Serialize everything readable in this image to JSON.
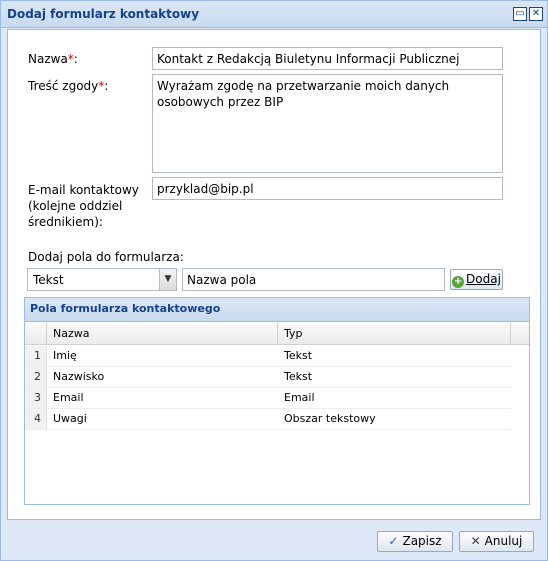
{
  "window": {
    "title": "Dodaj formularz kontaktowy"
  },
  "form": {
    "name_label": "Nazwa",
    "name_value": "Kontakt z Redakcją Biuletynu Informacji Publicznej",
    "consent_label": "Treść zgody",
    "consent_value": "Wyrażam zgodę na przetwarzanie moich danych osobowych przez BIP",
    "email_label_1": "E-mail kontaktowy",
    "email_label_2": "(kolejne oddziel",
    "email_label_3": "średnikiem):",
    "email_value": "przyklad@bip.pl",
    "add_fields_label": "Dodaj pola do formularza:",
    "type_select_value": "Tekst",
    "field_name_value": "Nazwa pola",
    "add_button": "Dodaj"
  },
  "grid": {
    "title": "Pola formularza kontaktowego",
    "columns": [
      "Nazwa",
      "Typ"
    ],
    "rows": [
      {
        "num": "1",
        "name": "Imię",
        "type": "Tekst"
      },
      {
        "num": "2",
        "name": "Nazwisko",
        "type": "Tekst"
      },
      {
        "num": "3",
        "name": "Email",
        "type": "Email"
      },
      {
        "num": "4",
        "name": "Uwagi",
        "type": "Obszar tekstowy"
      }
    ]
  },
  "footer": {
    "save_button": "Zapisz",
    "cancel_button": "Anuluj"
  },
  "colors": {
    "header_text": "#15428b",
    "panel_border": "#99bbe8",
    "window_bg": "#dfe8f6",
    "required_mark": "#cc0000"
  },
  "icons": [
    "restore-icon",
    "close-icon",
    "chevron-down-icon",
    "plus-icon",
    "check-icon",
    "x-icon"
  ]
}
